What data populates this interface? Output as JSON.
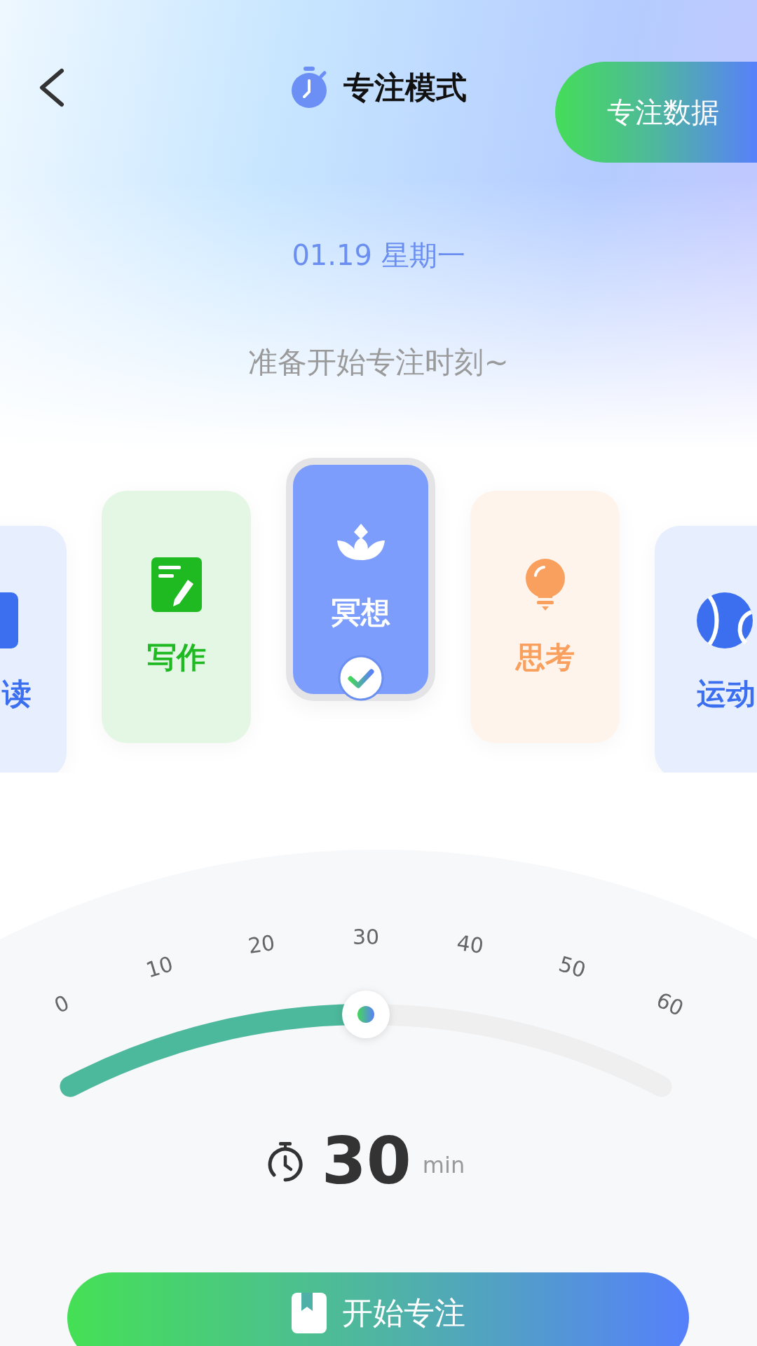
{
  "header": {
    "title": "专注模式",
    "data_button": "专注数据"
  },
  "date": "01.19 星期一",
  "prompt": "准备开始专注时刻~",
  "activities": [
    {
      "kind": "reading",
      "label": "读",
      "color": "#3b6ff0",
      "selected": false
    },
    {
      "kind": "writing",
      "label": "写作",
      "color": "#1fb922",
      "selected": false
    },
    {
      "kind": "meditation",
      "label": "冥想",
      "color": "#7d9dfc",
      "selected": true
    },
    {
      "kind": "thinking",
      "label": "思考",
      "color": "#f9a05e",
      "selected": false
    },
    {
      "kind": "sports",
      "label": "运动",
      "color": "#3b6ff0",
      "selected": false
    }
  ],
  "timer": {
    "ticks": [
      "0",
      "10",
      "20",
      "30",
      "40",
      "50",
      "60"
    ],
    "level": 0.5,
    "value": "30",
    "unit": "min"
  },
  "start_button": "开始专注"
}
